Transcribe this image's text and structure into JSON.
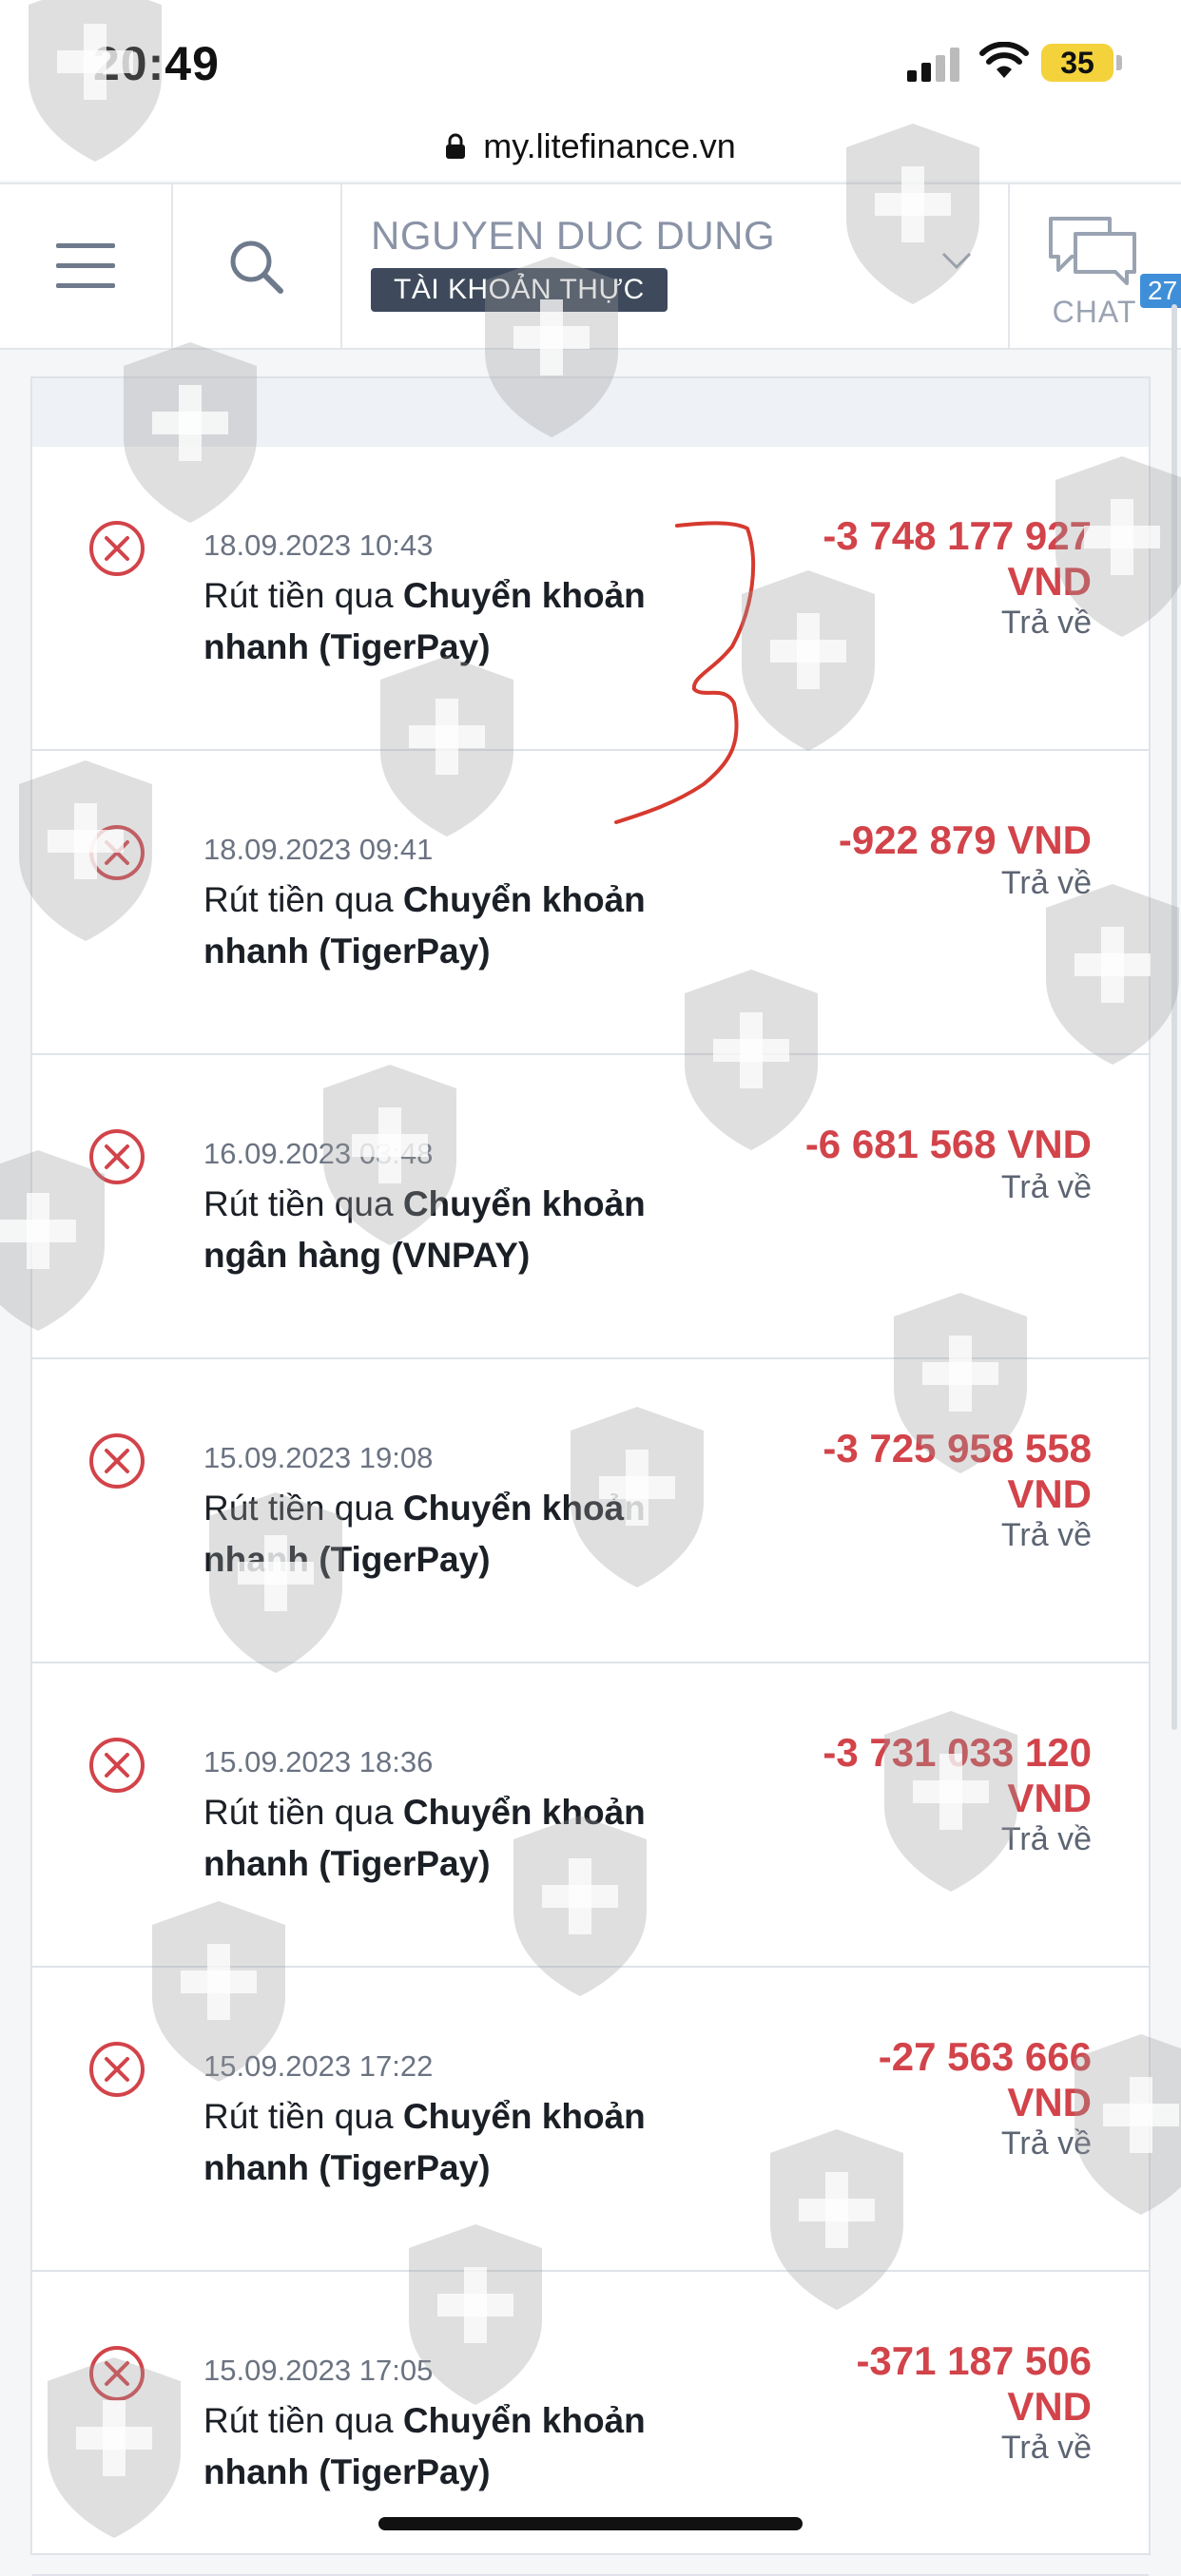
{
  "status_bar": {
    "time": "20:49",
    "battery": "35"
  },
  "browser": {
    "url": "my.litefinance.vn"
  },
  "header": {
    "account_name": "NGUYEN DUC DUNG",
    "account_type": "TÀI KHOẢN THỰC",
    "chat_count": "27",
    "chat_label": "CHAT"
  },
  "colors": {
    "amount": "#d2434a",
    "icon": "#d2434a",
    "badge_bg": "#3e4a5c",
    "chat_badge": "#3f8fd8",
    "annotation": "#d63a2f"
  },
  "transactions": [
    {
      "date": "18.09.2023 10:43",
      "desc_prefix": "Rút tiền qua ",
      "desc_bold_1": "Chuyển khoản",
      "desc_bold_2": "nhanh (TigerPay)",
      "amount_1": "-3 748 177 927",
      "amount_2": "VND",
      "status": "Trả về"
    },
    {
      "date": "18.09.2023 09:41",
      "desc_prefix": "Rút tiền qua ",
      "desc_bold_1": "Chuyển khoản",
      "desc_bold_2": "nhanh (TigerPay)",
      "amount_1": "-922 879 VND",
      "amount_2": "",
      "status": "Trả về"
    },
    {
      "date": "16.09.2023 03:48",
      "desc_prefix": "Rút tiền qua ",
      "desc_bold_1": "Chuyển khoản",
      "desc_bold_2": "ngân hàng (VNPAY)",
      "amount_1": "-6 681 568 VND",
      "amount_2": "",
      "status": "Trả về"
    },
    {
      "date": "15.09.2023 19:08",
      "desc_prefix": "Rút tiền qua ",
      "desc_bold_1": "Chuyển khoản",
      "desc_bold_2": "nhanh (TigerPay)",
      "amount_1": "-3 725 958 558",
      "amount_2": "VND",
      "status": "Trả về"
    },
    {
      "date": "15.09.2023 18:36",
      "desc_prefix": "Rút tiền qua ",
      "desc_bold_1": "Chuyển khoản",
      "desc_bold_2": "nhanh (TigerPay)",
      "amount_1": "-3 731 033 120",
      "amount_2": "VND",
      "status": "Trả về"
    },
    {
      "date": "15.09.2023 17:22",
      "desc_prefix": "Rút tiền qua ",
      "desc_bold_1": "Chuyển khoản",
      "desc_bold_2": "nhanh (TigerPay)",
      "amount_1": "-27 563 666",
      "amount_2": "VND",
      "status": "Trả về"
    },
    {
      "date": "15.09.2023 17:05",
      "desc_prefix": "Rút tiền qua ",
      "desc_bold_1": "Chuyển khoản",
      "desc_bold_2": "nhanh (TigerPay)",
      "amount_1": "-371 187 506",
      "amount_2": "VND",
      "status": "Trả về"
    }
  ]
}
